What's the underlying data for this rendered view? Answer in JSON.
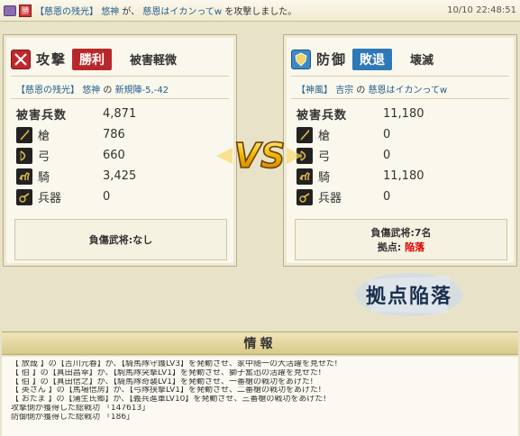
{
  "topbar": {
    "badge": "勝",
    "alliance": "【慈恩の残光】",
    "attacker": "悠神",
    "particle_ga": "が、",
    "target": "慈恩はイカンってw",
    "suffix": "を攻撃しました。",
    "timestamp": "10/10 22:48:51"
  },
  "attack": {
    "role": "攻撃",
    "result": "勝利",
    "damage": "被害軽微",
    "alliance": "【慈恩の残光】",
    "player": "悠神",
    "no": "の",
    "base": "新規陣-5,-42",
    "stats": [
      {
        "label": "被害兵数",
        "value": "4,871"
      },
      {
        "label": "槍",
        "value": "786",
        "icon": "spear-icon"
      },
      {
        "label": "弓",
        "value": "660",
        "icon": "bow-icon"
      },
      {
        "label": "騎",
        "value": "3,425",
        "icon": "horse-icon"
      },
      {
        "label": "兵器",
        "value": "0",
        "icon": "siege-icon"
      }
    ],
    "casualty_label": "負傷武将:",
    "casualty_value": "なし"
  },
  "defense": {
    "role": "防御",
    "result": "敗退",
    "damage": "壊滅",
    "alliance": "【神風】",
    "player": "吉宗",
    "no": "の",
    "base": "慈恩はイカンってw",
    "stats": [
      {
        "label": "被害兵数",
        "value": "11,180"
      },
      {
        "label": "槍",
        "value": "0",
        "icon": "spear-icon"
      },
      {
        "label": "弓",
        "value": "0",
        "icon": "bow-icon"
      },
      {
        "label": "騎",
        "value": "11,180",
        "icon": "horse-icon"
      },
      {
        "label": "兵器",
        "value": "0",
        "icon": "siege-icon"
      }
    ],
    "casualty_label": "負傷武将:",
    "casualty_value": "7名",
    "base_label": "拠点:",
    "base_value": "陥落"
  },
  "vs_text": "VS",
  "captured_text": "拠点陥落",
  "info": {
    "title": "情報",
    "lines": [
      "【 放哉 】の【吉川元春】が、【騎馬隊守護LV3】を発動させ、家中随一の大活躍を見せた!",
      "【 伯 】の【真田昌幸】が、【駒馬隊突撃LV1】を発動させ、獅子奮迅の活躍を見せた!",
      "【 伯 】の【真田信之】が、【騎馬隊奇襲LV1】を発動させ、一番槍の戦功をあげた!",
      "【 英さん 】の【馬場信房】が、【弓隊挟撃LV1】を発動させ、二番槍の戦功をあげた!",
      "【 おたま 】の【蒲生氏郷】が、【義兵進軍LV10】を発動させ、三番槍の戦功をあげた!",
      "攻撃側が獲得した総戦功 「147613」",
      "防御側が獲得した総戦功 「186」"
    ]
  },
  "colors": {
    "win": "#b8282b",
    "lose": "#2f78b8",
    "link": "#1f5d8c",
    "fallen": "#dd0000"
  }
}
